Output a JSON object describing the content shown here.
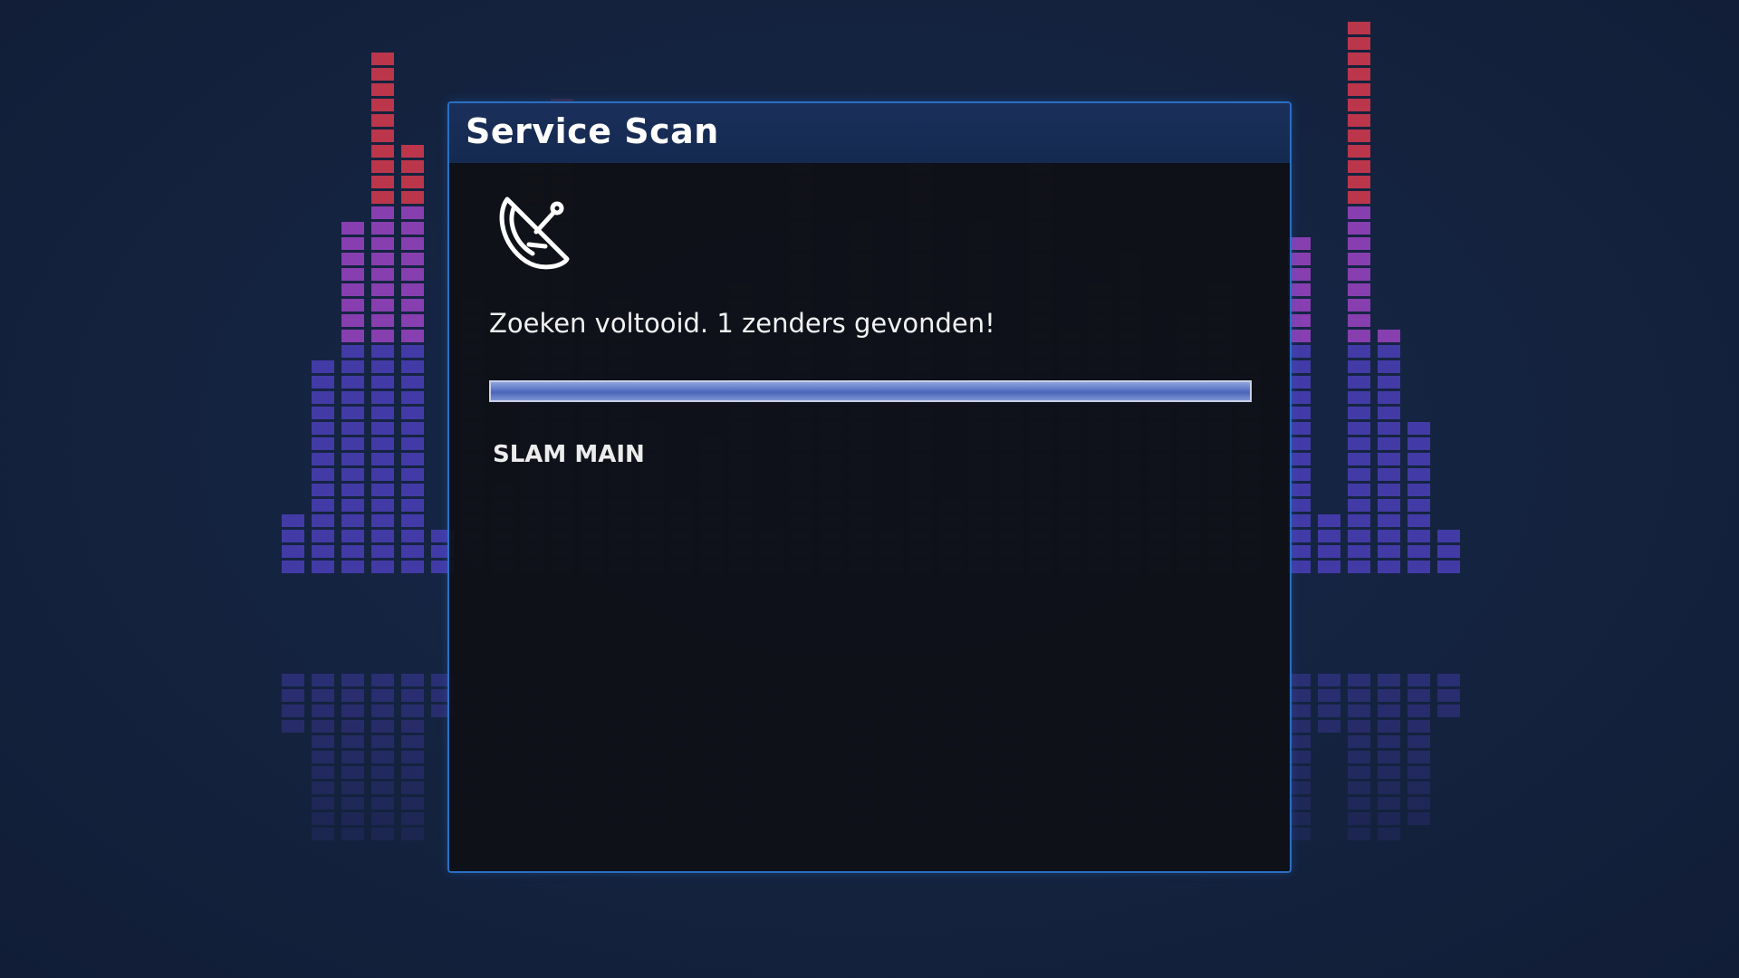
{
  "dialog": {
    "title": "Service Scan",
    "icon": "satellite-dish-icon",
    "status": "Zoeken voltooid. 1 zenders gevonden!",
    "progress": 1.0,
    "channels": [
      "SLAM MAIN"
    ]
  },
  "theme": {
    "background": "#14223e",
    "border_accent": "#2a6fc4",
    "progress_fill": "#5a74c4",
    "eq_low": "#4a3fb8",
    "eq_mid": "#9b44c4",
    "eq_high": "#d8394e"
  }
}
